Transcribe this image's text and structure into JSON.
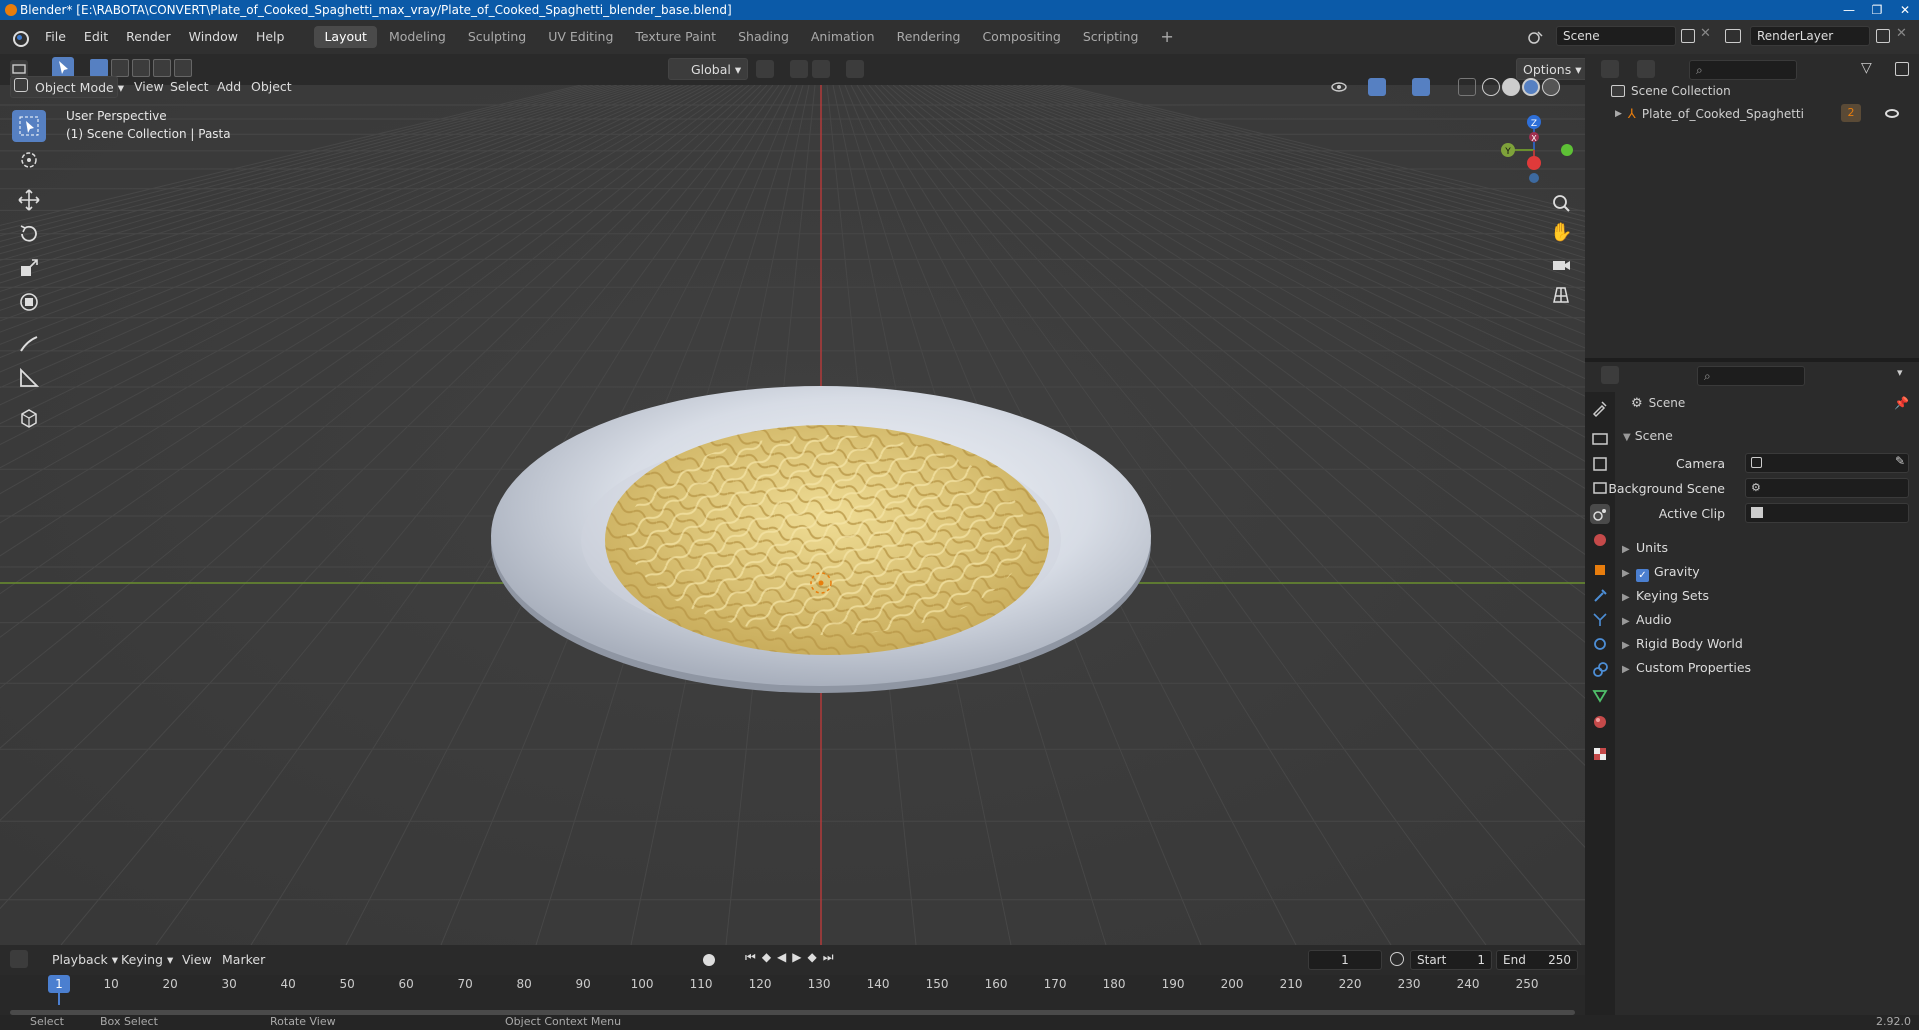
{
  "titlebar": {
    "title": "Blender* [E:\\RABOTA\\CONVERT\\Plate_of_Cooked_Spaghetti_max_vray/Plate_of_Cooked_Spaghetti_blender_base.blend]",
    "minimize": "—",
    "restore": "❐",
    "close": "✕"
  },
  "menubar": {
    "items": [
      "File",
      "Edit",
      "Render",
      "Window",
      "Help"
    ],
    "workspaces": [
      "Layout",
      "Modeling",
      "Sculpting",
      "UV Editing",
      "Texture Paint",
      "Shading",
      "Animation",
      "Rendering",
      "Compositing",
      "Scripting"
    ],
    "active_workspace": "Layout",
    "add_tab": "+",
    "scene_name": "Scene",
    "render_layer": "RenderLayer"
  },
  "viewport_header": {
    "mode": "Object Mode",
    "menus": [
      "View",
      "Select",
      "Add",
      "Object"
    ],
    "transform_orientation": "Global",
    "options": "Options"
  },
  "viewport": {
    "perspective": "User Perspective",
    "collection_info": "(1) Scene Collection | Pasta",
    "gizmo_axes": {
      "x": "X",
      "y": "Y",
      "z": "Z"
    },
    "colors": {
      "x_axis": "#b23a3a",
      "y_axis": "#6a8f2e",
      "plate": "#dfe3ea",
      "pasta": "#e2cc7e"
    }
  },
  "outliner": {
    "root": "Scene Collection",
    "items": [
      {
        "name": "Plate_of_Cooked_Spaghetti",
        "badge": "2"
      }
    ]
  },
  "properties": {
    "header_title": "Scene",
    "panel_title": "Scene",
    "fields": [
      {
        "label": "Camera",
        "value": ""
      },
      {
        "label": "Background Scene",
        "value": ""
      },
      {
        "label": "Active Clip",
        "value": ""
      }
    ],
    "sections": [
      "Units",
      "Gravity",
      "Keying Sets",
      "Audio",
      "Rigid Body World",
      "Custom Properties"
    ],
    "gravity_checked": true
  },
  "timeline": {
    "menus": [
      "Playback",
      "Keying",
      "View",
      "Marker"
    ],
    "current_frame": "1",
    "start_label": "Start",
    "start": "1",
    "end_label": "End",
    "end": "250",
    "ticks": [
      "10",
      "20",
      "30",
      "40",
      "50",
      "60",
      "70",
      "80",
      "90",
      "100",
      "110",
      "120",
      "130",
      "140",
      "150",
      "160",
      "170",
      "180",
      "190",
      "200",
      "210",
      "220",
      "230",
      "240",
      "250"
    ],
    "cursor_frame": "1"
  },
  "statusbar": {
    "items": [
      "Select",
      "Box Select",
      "Rotate View",
      "Object Context Menu"
    ],
    "version": "2.92.0"
  }
}
